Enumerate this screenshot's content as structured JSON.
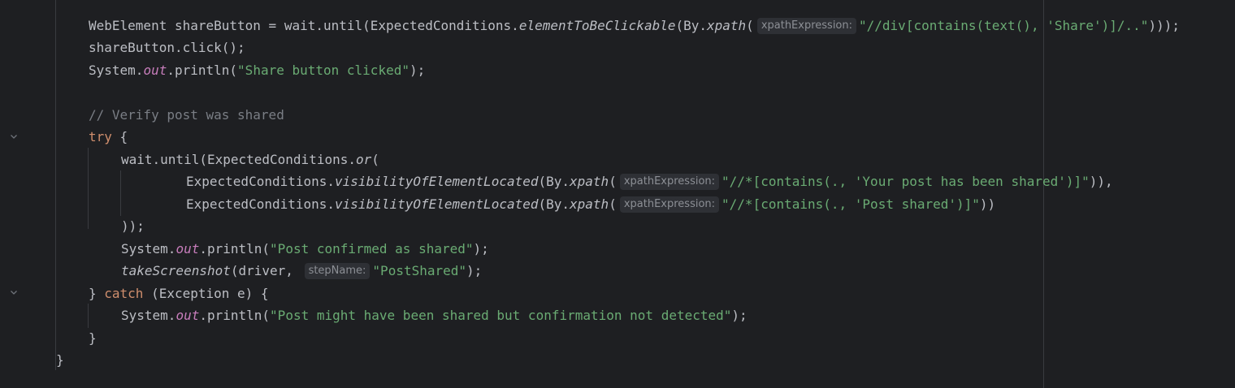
{
  "code": {
    "l1": {
      "a": "WebElement shareButton = wait.until(ExpectedConditions.",
      "m": "elementToBeClickable",
      "b": "(By.",
      "x": "xpath",
      "c": "(",
      "hint": "xpathExpression:",
      "s": "\"//div[contains(text(), 'Share')]/..\"",
      "d": ")));"
    },
    "l2": {
      "a": "shareButton.click();"
    },
    "l3": {
      "a": "System.",
      "f": "out",
      "b": ".println(",
      "s": "\"Share button clicked\"",
      "c": ");"
    },
    "l4": {
      "cmt": "// Verify post was shared"
    },
    "l5": {
      "kw": "try",
      "a": " {"
    },
    "l6": {
      "a": "wait.until(ExpectedConditions.",
      "m": "or",
      "b": "("
    },
    "l7": {
      "a": "ExpectedConditions.",
      "m": "visibilityOfElementLocated",
      "b": "(By.",
      "x": "xpath",
      "c": "(",
      "hint": "xpathExpression:",
      "s": "\"//*[contains(., 'Your post has been shared')]\"",
      "d": ")),"
    },
    "l8": {
      "a": "ExpectedConditions.",
      "m": "visibilityOfElementLocated",
      "b": "(By.",
      "x": "xpath",
      "c": "(",
      "hint": "xpathExpression:",
      "s": "\"//*[contains(., 'Post shared')]\"",
      "d": "))"
    },
    "l9": {
      "a": "));"
    },
    "l10": {
      "a": "System.",
      "f": "out",
      "b": ".println(",
      "s": "\"Post confirmed as shared\"",
      "c": ");"
    },
    "l11": {
      "m": "takeScreenshot",
      "a": "(driver, ",
      "hint": "stepName:",
      "s": "\"PostShared\"",
      "c": ");"
    },
    "l12": {
      "a": "} ",
      "kw": "catch",
      "b": " (Exception e) {"
    },
    "l13": {
      "a": "System.",
      "f": "out",
      "b": ".println(",
      "s": "\"Post might have been shared but confirmation not detected\"",
      "c": ");"
    },
    "l14": {
      "a": "}"
    },
    "l15": {
      "a": "}"
    }
  },
  "icons": {
    "fold": "chevron-down-icon"
  },
  "colors": {
    "background": "#1e1f22",
    "text": "#bcbec4",
    "keyword": "#cf8e6d",
    "string": "#6aab73",
    "comment": "#7a7e85",
    "field": "#c77dbb",
    "hint_bg": "#2e3035",
    "hint_text": "#8c8f95"
  }
}
